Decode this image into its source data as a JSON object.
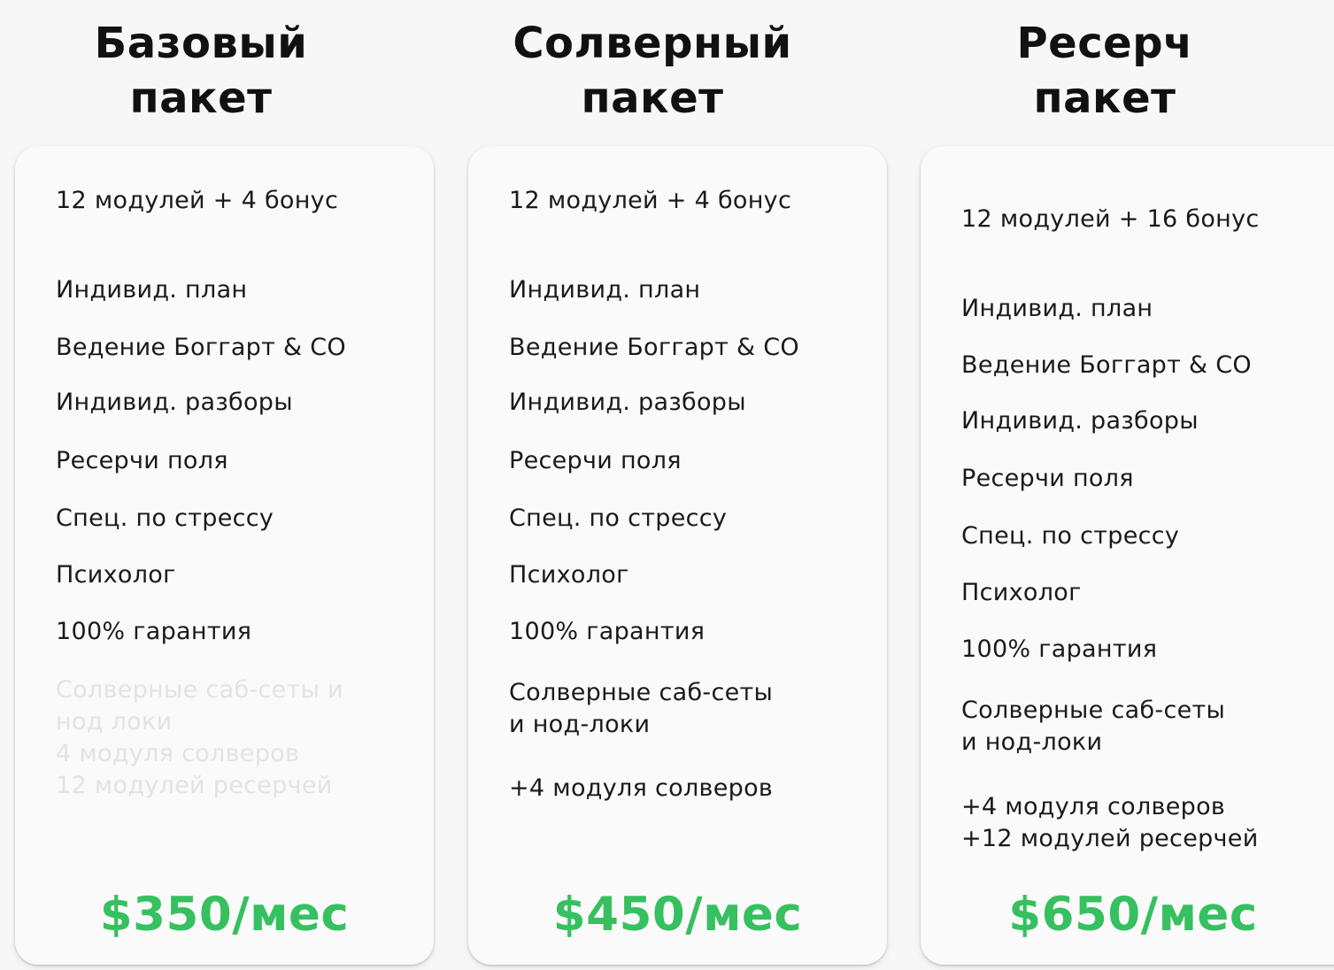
{
  "packages": [
    {
      "title_line1": "Базовый",
      "title_line2": "пакет",
      "features": [
        "12 модулей + 4 бонус",
        "Индивид. план",
        "Ведение Боггарт & CO",
        "Индивид. разборы",
        "Ресерчи поля",
        "Спец. по стрессу",
        "Психолог",
        "100% гарантия"
      ],
      "unavailable": [
        "Солверные саб-сеты и",
        "нод локи",
        "4 модуля солверов",
        "12 модулей ресерчей"
      ],
      "price": "$350/мес"
    },
    {
      "title_line1": "Солверный",
      "title_line2": "пакет",
      "features": [
        "12 модулей + 4 бонус",
        "Индивид. план",
        "Ведение Боггарт & CO",
        "Индивид. разборы",
        "Ресерчи поля",
        "Спец. по стрессу",
        "Психолог",
        "100% гарантия",
        "Солверные саб-сеты",
        "и нод-локи",
        "+4 модуля солверов"
      ],
      "price": "$450/мес"
    },
    {
      "title_line1": "Ресерч",
      "title_line2": "пакет",
      "features": [
        "12 модулей + 16 бонус",
        "Индивид. план",
        "Ведение Боггарт & CO",
        "Индивид. разборы",
        "Ресерчи поля",
        "Спец. по стрессу",
        "Психолог",
        "100% гарантия",
        "Солверные саб-сеты",
        "и нод-локи",
        "+4 модуля солверов",
        "+12 модулей ресерчей"
      ],
      "price": "$650/мес"
    }
  ],
  "colors": {
    "price": "#36c060",
    "text": "#1a1a1a",
    "unavailable_text": "#e3e3e3",
    "card_bg": "#fafafa",
    "page_bg": "#f7f7f7"
  }
}
